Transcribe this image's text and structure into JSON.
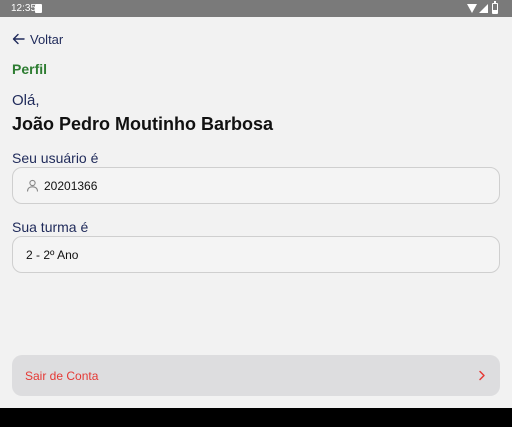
{
  "status_bar": {
    "time": "12:35",
    "icons": [
      "sd-card-icon",
      "wifi-icon",
      "signal-icon",
      "battery-icon"
    ]
  },
  "nav": {
    "back_label": "Voltar"
  },
  "section_title": "Perfil",
  "greeting": "Olá,",
  "user_name": "João Pedro Moutinho Barbosa",
  "user_field": {
    "label": "Seu usuário é",
    "value": "20201366",
    "icon": "person-icon"
  },
  "class_field": {
    "label": "Sua turma é",
    "value": "2 - 2º Ano"
  },
  "logout": {
    "label": "Sair de Conta",
    "icon": "chevron-right-icon"
  },
  "colors": {
    "title_green": "#2e7d32",
    "text_navy": "#1f2a5a",
    "logout_red": "#e53935",
    "status_bar": "#7a7a7a",
    "background": "#f2f2f2"
  }
}
